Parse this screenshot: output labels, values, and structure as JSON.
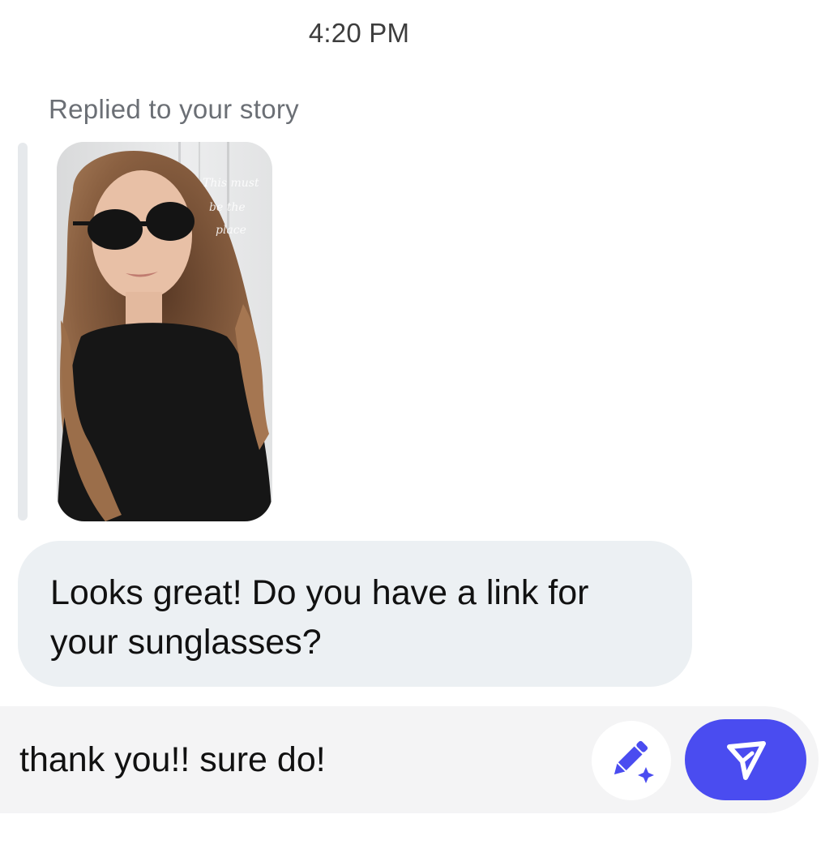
{
  "thread": {
    "timestamp": "4:20 PM",
    "reply_label": "Replied to your story",
    "story": {
      "overlay_text": [
        "This must",
        "be the",
        "place"
      ]
    },
    "incoming_message": {
      "line1": "Looks great! Do you have a link for",
      "line2": "your sunglasses?"
    }
  },
  "composer": {
    "draft_text": "thank you!! sure do!",
    "ai_icon": "pencil-sparkle-icon",
    "send_icon": "paper-plane-icon"
  },
  "colors": {
    "accent": "#4a4cf0",
    "bubble": "#ecf0f3",
    "composer_bg": "#f4f4f5"
  }
}
